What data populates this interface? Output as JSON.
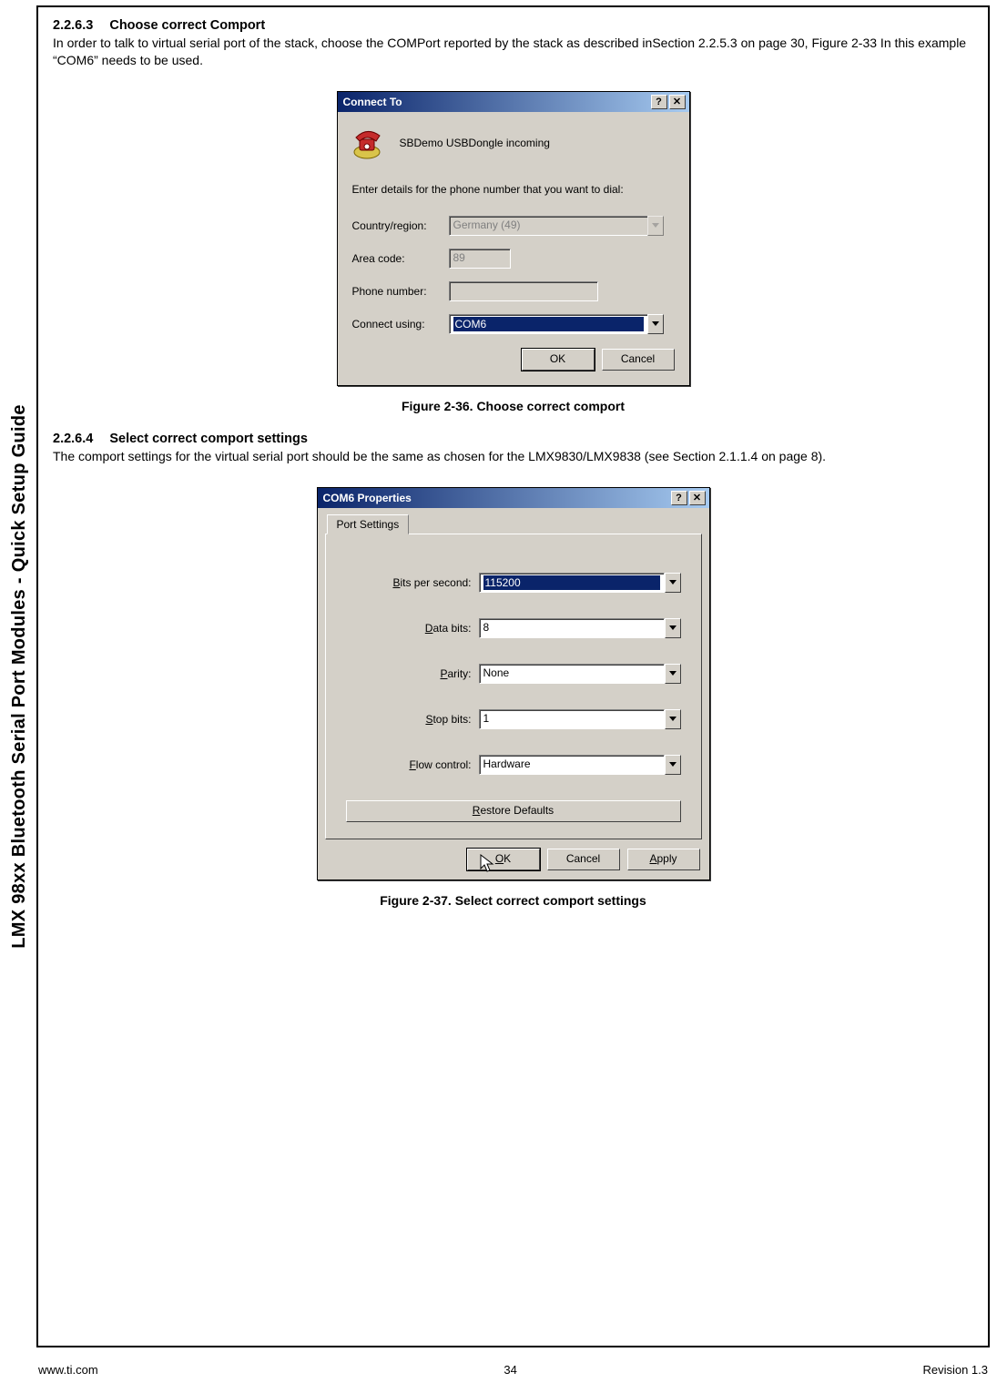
{
  "vertical_title": "LMX 98xx Bluetooth Serial Port Modules - Quick Setup Guide",
  "section1": {
    "number": "2.2.6.3",
    "title": "Choose correct Comport",
    "para": "In order to talk to virtual serial port of the stack, choose the COMPort reported by the stack as described inSection 2.2.5.3 on page 30, Figure 2-33 In this example “COM6” needs to be used."
  },
  "dlg1": {
    "title": "Connect To",
    "help_btn": "?",
    "close_btn": "✕",
    "icon_label": "SBDemo USBDongle incoming",
    "instruction": "Enter details for the phone number that you want to dial:",
    "country_lbl": "Country/region:",
    "country_val": "Germany (49)",
    "area_lbl": "Area code:",
    "area_val": "89",
    "phone_lbl": "Phone number:",
    "phone_val": "",
    "connect_lbl": "Connect using:",
    "connect_val": "COM6",
    "ok": "OK",
    "cancel": "Cancel"
  },
  "fig1_caption": "Figure 2-36.  Choose correct comport",
  "section2": {
    "number": "2.2.6.4",
    "title": "Select correct comport settings",
    "para": "The comport settings for the virtual serial port should be the same as chosen for the LMX9830/LMX9838 (see Section 2.1.1.4 on page 8)."
  },
  "dlg2": {
    "title": "COM6 Properties",
    "help_btn": "?",
    "close_btn": "✕",
    "tab": "Port Settings",
    "bits_lbl_pre": "B",
    "bits_lbl_post": "its per second:",
    "bits_val": "115200",
    "databits_lbl_pre": "D",
    "databits_lbl_post": "ata bits:",
    "databits_val": "8",
    "parity_lbl_pre": "P",
    "parity_lbl_post": "arity:",
    "parity_val": "None",
    "stopbits_lbl_pre": "S",
    "stopbits_lbl_post": "top bits:",
    "stopbits_val": "1",
    "flow_lbl_pre": "F",
    "flow_lbl_post": "low control:",
    "flow_val": "Hardware",
    "restore_pre": "R",
    "restore_post": "estore Defaults",
    "ok_pre": "O",
    "ok_post": "K",
    "cancel": "Cancel",
    "apply_pre": "A",
    "apply_post": "pply"
  },
  "fig2_caption": "Figure 2-37.  Select correct comport settings",
  "footer": {
    "left": "www.ti.com",
    "center": "34",
    "right": "Revision 1.3"
  }
}
